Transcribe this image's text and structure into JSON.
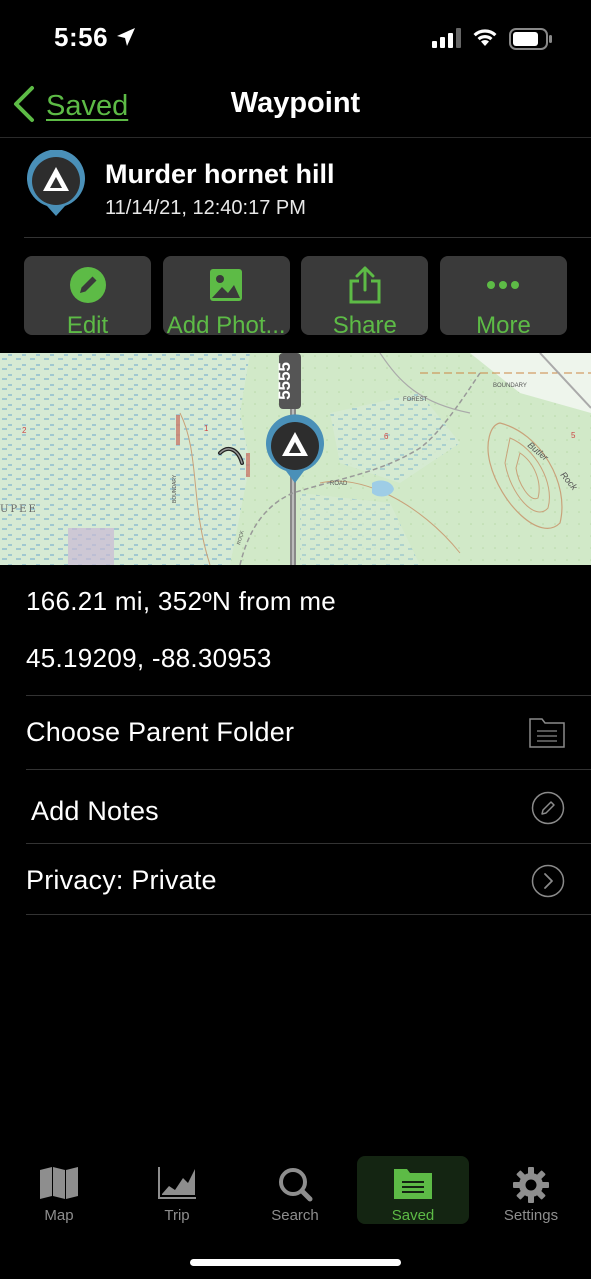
{
  "status_bar": {
    "time": "5:56"
  },
  "nav": {
    "back_label": "Saved",
    "title": "Waypoint"
  },
  "waypoint": {
    "name": "Murder hornet hill",
    "timestamp": "11/14/21, 12:40:17 PM"
  },
  "actions": [
    {
      "label": "Edit",
      "icon": "pencil-icon"
    },
    {
      "label": "Add Phot...",
      "icon": "image-icon"
    },
    {
      "label": "Share",
      "icon": "share-icon"
    },
    {
      "label": "More",
      "icon": "more-icon"
    }
  ],
  "map": {
    "labels": {
      "road_number": "5555",
      "place": "UPEE",
      "forest": "FOREST",
      "boundary": "BOUNDARY",
      "butler": "Butler",
      "rock": "Rock",
      "road": "ROAD",
      "section_1": "1",
      "section_2": "2",
      "section_5": "5",
      "section_6": "6",
      "boundary_side": "BOUNDARY",
      "rock_side": "ROCK"
    }
  },
  "distance": "166.21 mi, 352ºN from me",
  "coordinates": "45.19209, -88.30953",
  "rows": {
    "parent_folder": "Choose Parent Folder",
    "notes": "Add Notes",
    "privacy": "Privacy: Private"
  },
  "tabs": [
    {
      "label": "Map",
      "icon": "map-icon"
    },
    {
      "label": "Trip",
      "icon": "chart-icon"
    },
    {
      "label": "Search",
      "icon": "search-icon"
    },
    {
      "label": "Saved",
      "icon": "folder-icon",
      "active": true
    },
    {
      "label": "Settings",
      "icon": "gear-icon"
    }
  ],
  "colors": {
    "accent": "#5dbb46",
    "button_bg": "#3a3a3a",
    "pin": "#4a90b8"
  }
}
